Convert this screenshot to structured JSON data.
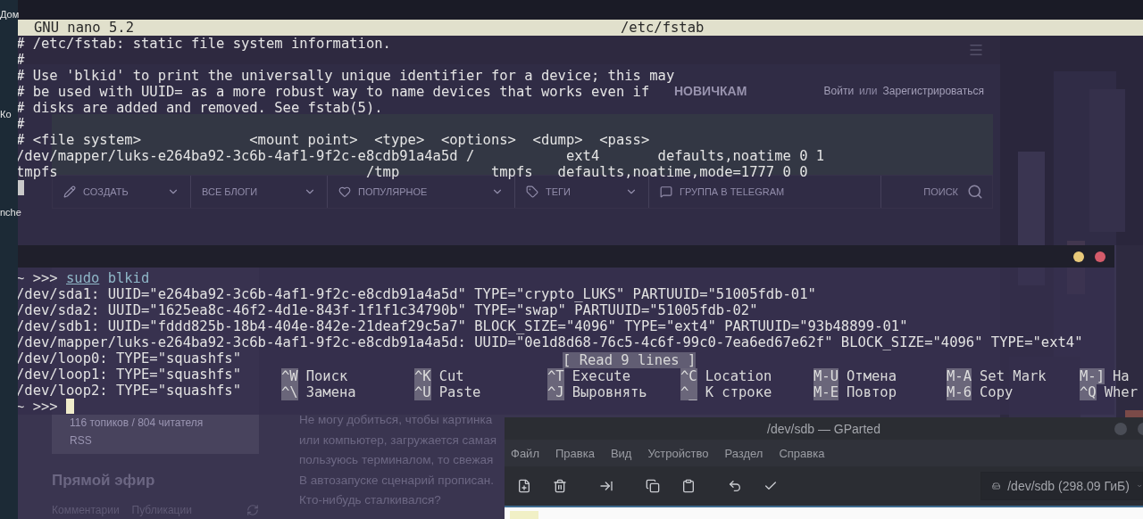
{
  "desktop": {
    "icon_labels": [
      "Дом",
      "Ко",
      "nche"
    ]
  },
  "browser": {
    "nav": [
      "НОВИЧКАМ"
    ],
    "auth": {
      "login": "Войти",
      "or": "или",
      "register": "Зарегистрироваться"
    },
    "toolbar": [
      {
        "label": "СОЗДАТЬ",
        "kind": "pencil",
        "dropdown": true
      },
      {
        "label": "ВСЕ БЛОГИ",
        "kind": "plain",
        "dropdown": true
      },
      {
        "label": "ПОПУЛЯРНОЕ",
        "kind": "heart",
        "dropdown": true
      },
      {
        "label": "ТЕГИ",
        "kind": "tag",
        "dropdown": true
      },
      {
        "label": "ГРУППА В TELEGRAM",
        "kind": "chat",
        "dropdown": false
      }
    ],
    "search_placeholder": "ПОИСК",
    "blog_stats": "116 топиков / 804 читателя",
    "rss": "RSS",
    "live_title": "Прямой эфир",
    "live_tabs": [
      "Комментарии",
      "Публикации"
    ],
    "article_lines": [
      "Не могу добиться, чтобы картинка",
      "или компьютер, загружается самая",
      "пользуюсь терминалом, то свежая",
      "В автозапуске сценарий прописан.",
      "Кто-нибудь сталкивался?"
    ]
  },
  "nano": {
    "title": "GNU nano 5.2",
    "filename": "/etc/fstab",
    "lines": [
      "# /etc/fstab: static file system information.",
      "#",
      "# Use 'blkid' to print the universally unique identifier for a device; this may",
      "# be used with UUID= as a more robust way to name devices that works even if",
      "# disks are added and removed. See fstab(5).",
      "#",
      "# <file system>             <mount point>  <type>  <options>  <dump>  <pass>",
      "/dev/mapper/luks-e264ba92-3c6b-4af1-9f2c-e8cdb91a4a5d /           ext4       defaults,noatime 0 1",
      "tmpfs                                     /tmp           tmpfs   defaults,noatime,mode=1777 0 0"
    ],
    "status": "[ Read 9 lines ]",
    "shortcuts": [
      [
        {
          "key": "^W",
          "label": "Поиск"
        },
        {
          "key": "^K",
          "label": "Cut"
        },
        {
          "key": "^T",
          "label": "Execute"
        },
        {
          "key": "^C",
          "label": "Location"
        },
        {
          "key": "M-U",
          "label": "Отмена"
        },
        {
          "key": "M-A",
          "label": "Set Mark"
        },
        {
          "key": "M-]",
          "label": "Ha"
        }
      ],
      [
        {
          "key": "^\\",
          "label": "Замена"
        },
        {
          "key": "^U",
          "label": "Paste"
        },
        {
          "key": "^J",
          "label": "Выровнять"
        },
        {
          "key": "^_",
          "label": "К строке"
        },
        {
          "key": "M-E",
          "label": "Повтор"
        },
        {
          "key": "M-6",
          "label": "Copy"
        },
        {
          "key": "^Q",
          "label": "Wher"
        }
      ]
    ]
  },
  "terminal": {
    "prompt": "~ >>>",
    "command": [
      {
        "text": "sudo",
        "underlined": true
      },
      {
        "text": "blkid",
        "underlined": false
      }
    ],
    "output": [
      "/dev/sda1: UUID=\"e264ba92-3c6b-4af1-9f2c-e8cdb91a4a5d\" TYPE=\"crypto_LUKS\" PARTUUID=\"51005fdb-01\"",
      "/dev/sda2: UUID=\"1625ea8c-46f2-4d1e-843f-1f1f1c34790b\" TYPE=\"swap\" PARTUUID=\"51005fdb-02\"",
      "/dev/sdb1: UUID=\"fddd825b-18b4-404e-842e-21deaf29c5a7\" BLOCK_SIZE=\"4096\" TYPE=\"ext4\" PARTUUID=\"93b48899-01\"",
      "/dev/mapper/luks-e264ba92-3c6b-4af1-9f2c-e8cdb91a4a5d: UUID=\"0e1d8d68-76c5-4c6f-99c0-7ea6ed67e62f\" BLOCK_SIZE=\"4096\" TYPE=\"ext4\"",
      "/dev/loop0: TYPE=\"squashfs\"",
      "/dev/loop1: TYPE=\"squashfs\"",
      "/dev/loop2: TYPE=\"squashfs\""
    ],
    "final_prompt": "~ >>>"
  },
  "gparted": {
    "title": "/dev/sdb — GParted",
    "menu": [
      "Файл",
      "Правка",
      "Вид",
      "Устройство",
      "Раздел",
      "Справка"
    ],
    "tools": [
      {
        "kind": "new"
      },
      {
        "kind": "delete"
      },
      {
        "kind": "resize"
      },
      {
        "kind": "copy"
      },
      {
        "kind": "paste"
      },
      {
        "kind": "undo"
      },
      {
        "kind": "apply"
      }
    ],
    "device": "/dev/sdb (298.09 ГиБ)"
  }
}
